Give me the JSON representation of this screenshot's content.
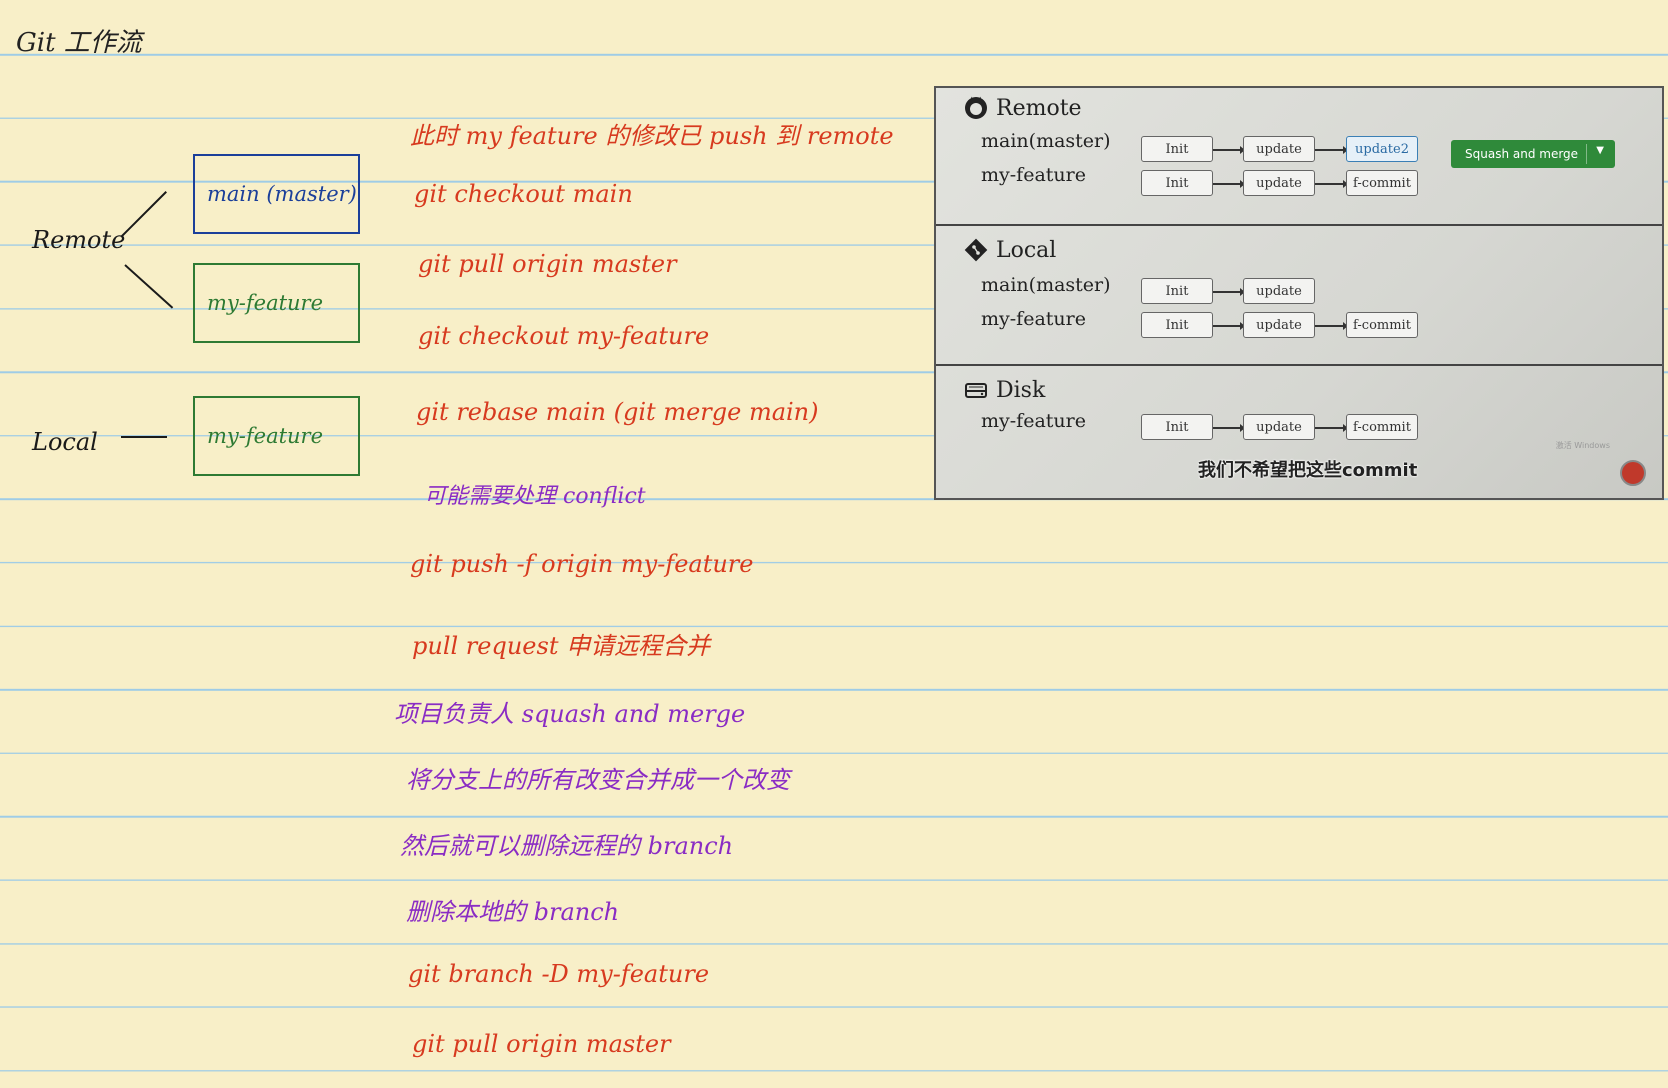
{
  "title": "Git 工作流",
  "diagram": {
    "remote_label": "Remote",
    "local_label": "Local",
    "remote_main": "main (master)",
    "remote_feature": "my-feature",
    "local_feature": "my-feature",
    "colors": {
      "main_box": "#1b3f9a",
      "feature_box": "#2e7a33"
    }
  },
  "notes": [
    "此时 my feature 的修改已 push 到 remote",
    "git checkout main",
    "git pull origin master",
    "git checkout my-feature",
    "git rebase main (git merge main)",
    "可能需要处理 conflict",
    "git push -f origin my-feature",
    "pull request 申请远程合并",
    "项目负责人 squash and merge",
    "将分支上的所有改变合并成一个改变",
    "然后就可以删除远程的 branch",
    "删除本地的 branch",
    "git branch -D my-feature",
    "git pull origin master"
  ],
  "note_colors": {
    "red": "#d73a1f",
    "purple": "#8a2cc4"
  },
  "photo": {
    "remote": {
      "title": "Remote",
      "main_label": "main(master)",
      "feature_label": "my-feature",
      "main_commits": [
        "Init",
        "update",
        "update2"
      ],
      "feature_commits": [
        "Init",
        "update",
        "f-commit"
      ],
      "squash_button": "Squash and merge"
    },
    "local": {
      "title": "Local",
      "main_label": "main(master)",
      "feature_label": "my-feature",
      "main_commits": [
        "Init",
        "update"
      ],
      "feature_commits": [
        "Init",
        "update",
        "f-commit"
      ]
    },
    "disk": {
      "title": "Disk",
      "feature_label": "my-feature",
      "feature_commits": [
        "Init",
        "update",
        "f-commit"
      ]
    },
    "subtitle": "我们不希望把这些commit",
    "watermark": "激活 Windows"
  }
}
